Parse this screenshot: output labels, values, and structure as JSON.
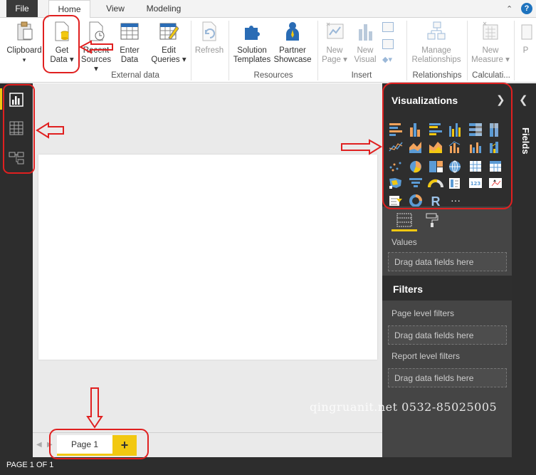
{
  "ribbon_tabs": {
    "file": "File",
    "home": "Home",
    "view": "View",
    "modeling": "Modeling"
  },
  "help_label": "?",
  "ribbon": {
    "clipboard": "Clipboard",
    "get_data_1": "Get",
    "get_data_2": "Data ▾",
    "recent_1": "Recent",
    "recent_2": "Sources ▾",
    "enter_1": "Enter",
    "enter_2": "Data",
    "edit_1": "Edit",
    "edit_2": "Queries ▾",
    "refresh": "Refresh",
    "solution_1": "Solution",
    "solution_2": "Templates",
    "partner_1": "Partner",
    "partner_2": "Showcase",
    "newpage_1": "New",
    "newpage_2": "Page ▾",
    "newvisual_1": "New",
    "newvisual_2": "Visual",
    "manage_1": "Manage",
    "manage_2": "Relationships",
    "newmeasure_1": "New",
    "newmeasure_2": "Measure ▾",
    "cut_p": "P",
    "groups": {
      "external_data": "External data",
      "resources": "Resources",
      "insert": "Insert",
      "relationships": "Relationships",
      "calculations": "Calculati..."
    }
  },
  "visualizations": {
    "title": "Visualizations",
    "more": "···",
    "r_label": "R",
    "values_label": "Values",
    "drag_here": "Drag data fields here"
  },
  "filters": {
    "title": "Filters",
    "page_level": "Page level filters",
    "report_level": "Report level filters",
    "drag_here_1": "Drag data fields here",
    "drag_here_2": "Drag data fields here"
  },
  "fields_pane": {
    "title": "Fields"
  },
  "pages": {
    "tab": "Page 1",
    "add": "+"
  },
  "status": "PAGE 1 OF 1",
  "watermark": "qingruanit.net 0532-85025005",
  "colors": {
    "accent": "#f2c811",
    "annotation": "#e02020",
    "pane_dark": "#2e2e2e",
    "pane_mid": "#454545"
  }
}
